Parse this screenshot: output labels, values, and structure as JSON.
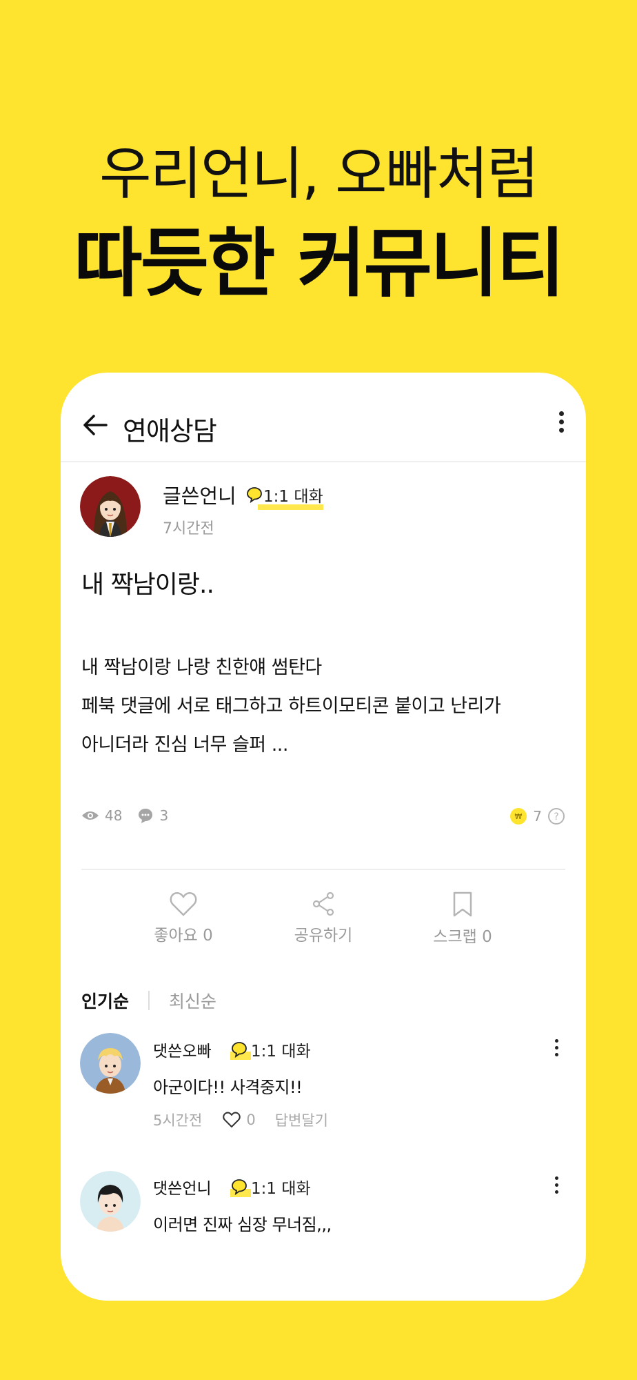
{
  "headline": {
    "line1": "우리언니, 오빠처럼",
    "line2": "따듯한 커뮤니티"
  },
  "appbar": {
    "title": "연애상담"
  },
  "post": {
    "author": "글쓴언니",
    "chat_label": "1:1 대화",
    "time": "7시간전",
    "title": "내 짝남이랑..",
    "body_lines": [
      "내 짝남이랑 나랑 친한얘 썸탄다",
      "페북 댓글에 서로 태그하고 하트이모티콘 붙이고 난리가",
      "아니더라 진심 너무 슬퍼 ..."
    ],
    "views": "48",
    "comments": "3",
    "reward": "7"
  },
  "actions": {
    "like": "좋아요 0",
    "share": "공유하기",
    "scrap": "스크랩 0"
  },
  "sort": {
    "popular": "인기순",
    "latest": "최신순"
  },
  "comments": [
    {
      "author": "댓쓴오빠",
      "chat_label": "1:1 대화",
      "text": "아군이다!! 사격중지!!",
      "time": "5시간전",
      "likes": "0",
      "reply": "답변달기"
    },
    {
      "author": "댓쓴언니",
      "chat_label": "1:1 대화",
      "text": "이러면 진짜 심장 무너짐,,,"
    }
  ],
  "colors": {
    "background": "#FEE42F",
    "accent": "#FEE42F",
    "muted_text": "#9a9a9a"
  }
}
